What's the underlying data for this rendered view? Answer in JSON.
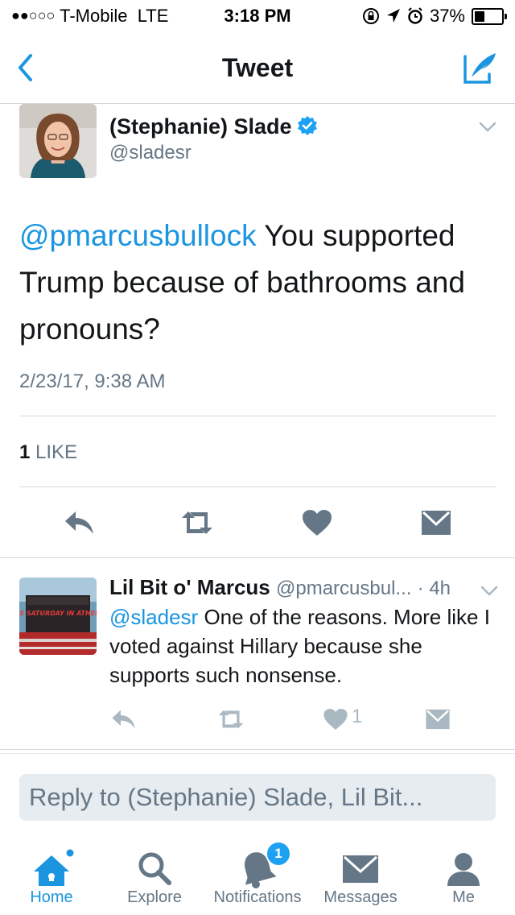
{
  "status_bar": {
    "signal": "●●○○○",
    "carrier": "T-Mobile",
    "network": "LTE",
    "time": "3:18 PM",
    "battery": "37%",
    "battery_level": 0.37
  },
  "nav": {
    "title": "Tweet"
  },
  "tweet": {
    "author_name": "(Stephanie) Slade",
    "author_handle": "@sladesr",
    "mention": "@pmarcusbullock",
    "text": " You supported Trump because of bathrooms and pronouns?",
    "timestamp": "2/23/17, 9:38 AM",
    "like_count": "1",
    "like_label": " LIKE"
  },
  "reply": {
    "author_name": "Lil Bit o' Marcus",
    "author_handle": "@pmarcusbul...",
    "age": "· 4h",
    "mention": "@sladesr",
    "text": " One of the reasons. More like I voted against Hillary because she supports such nonsense.",
    "like_count": "1",
    "avatar_text": "IT'S SATURDAY IN ATHENS"
  },
  "reply_box": {
    "placeholder": "Reply to (Stephanie) Slade, Lil Bit..."
  },
  "tabs": [
    {
      "label": "Home",
      "icon": "home-icon"
    },
    {
      "label": "Explore",
      "icon": "search-icon"
    },
    {
      "label": "Notifications",
      "icon": "bell-icon",
      "badge": "1"
    },
    {
      "label": "Messages",
      "icon": "envelope-icon"
    },
    {
      "label": "Me",
      "icon": "person-icon"
    }
  ],
  "colors": {
    "accent": "#1b95e0",
    "text": "#14171a",
    "muted": "#657786",
    "icon_dark": "#657786",
    "icon_light": "#aab8c2",
    "divider": "#d6d9dc"
  }
}
